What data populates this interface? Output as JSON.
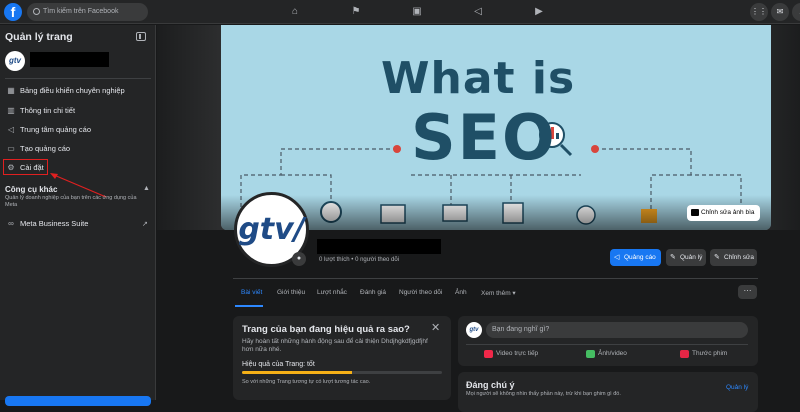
{
  "topbar": {
    "logo": "f",
    "search_placeholder": "Tìm kiếm trên Facebook",
    "nav_icons": [
      "home-icon",
      "flag-icon",
      "marketplace-icon",
      "megaphone-icon",
      "watch-icon"
    ],
    "right_icons": [
      "menu-grid-icon",
      "messenger-icon",
      "bell-icon"
    ]
  },
  "sidebar": {
    "title": "Quản lý trang",
    "page_avatar_text": "gtv",
    "items": [
      {
        "icon": "dashboard-icon",
        "label": "Bảng điều khiển chuyên nghiệp"
      },
      {
        "icon": "info-icon",
        "label": "Thông tin chi tiết"
      },
      {
        "icon": "megaphone-icon",
        "label": "Trung tâm quảng cáo"
      },
      {
        "icon": "ad-icon",
        "label": "Tạo quảng cáo"
      },
      {
        "icon": "gear-icon",
        "label": "Cài đặt"
      }
    ],
    "tools": {
      "title": "Công cụ khác",
      "description": "Quản lý doanh nghiệp của bạn trên các ứng dụng của Meta",
      "item": "Meta Business Suite"
    }
  },
  "cover": {
    "headline_1": "What is",
    "headline_2": "SEO",
    "edit_label": "Chỉnh sửa ảnh bìa"
  },
  "profile": {
    "logo_text": "gtv/",
    "stats": "0 lượt thích • 0 người theo dõi",
    "buttons": {
      "ads": "Quảng cáo",
      "manage": "Quản lý",
      "edit": "Chỉnh sửa"
    }
  },
  "tabs": [
    "Bài viết",
    "Giới thiệu",
    "Lượt nhắc",
    "Đánh giá",
    "Người theo dõi",
    "Ảnh",
    "Xem thêm ▾"
  ],
  "more_label": "···",
  "performance": {
    "title": "Trang của bạn đang hiệu quả ra sao?",
    "description": "Hãy hoàn tất những hành động sau để cải thiện Dhdjhgkdfjgdfjhf hơn nữa nhé.",
    "status": "Hiệu quả của Trang: tốt",
    "progress": 0.55,
    "note": "So với những Trang tương tự có lượt tương tác cao."
  },
  "composer": {
    "avatar_text": "gtv",
    "placeholder": "Bạn đang nghĩ gì?",
    "actions": [
      "Video trực tiếp",
      "Ảnh/video",
      "Thước phim"
    ],
    "action_colors": [
      "#f02849",
      "#45bd62",
      "#e42645"
    ]
  },
  "notes": {
    "title": "Đáng chú ý",
    "manage": "Quản lý",
    "description": "Mọi người sẽ không nhìn thấy phần này, trừ khi bạn ghim gì đó."
  }
}
